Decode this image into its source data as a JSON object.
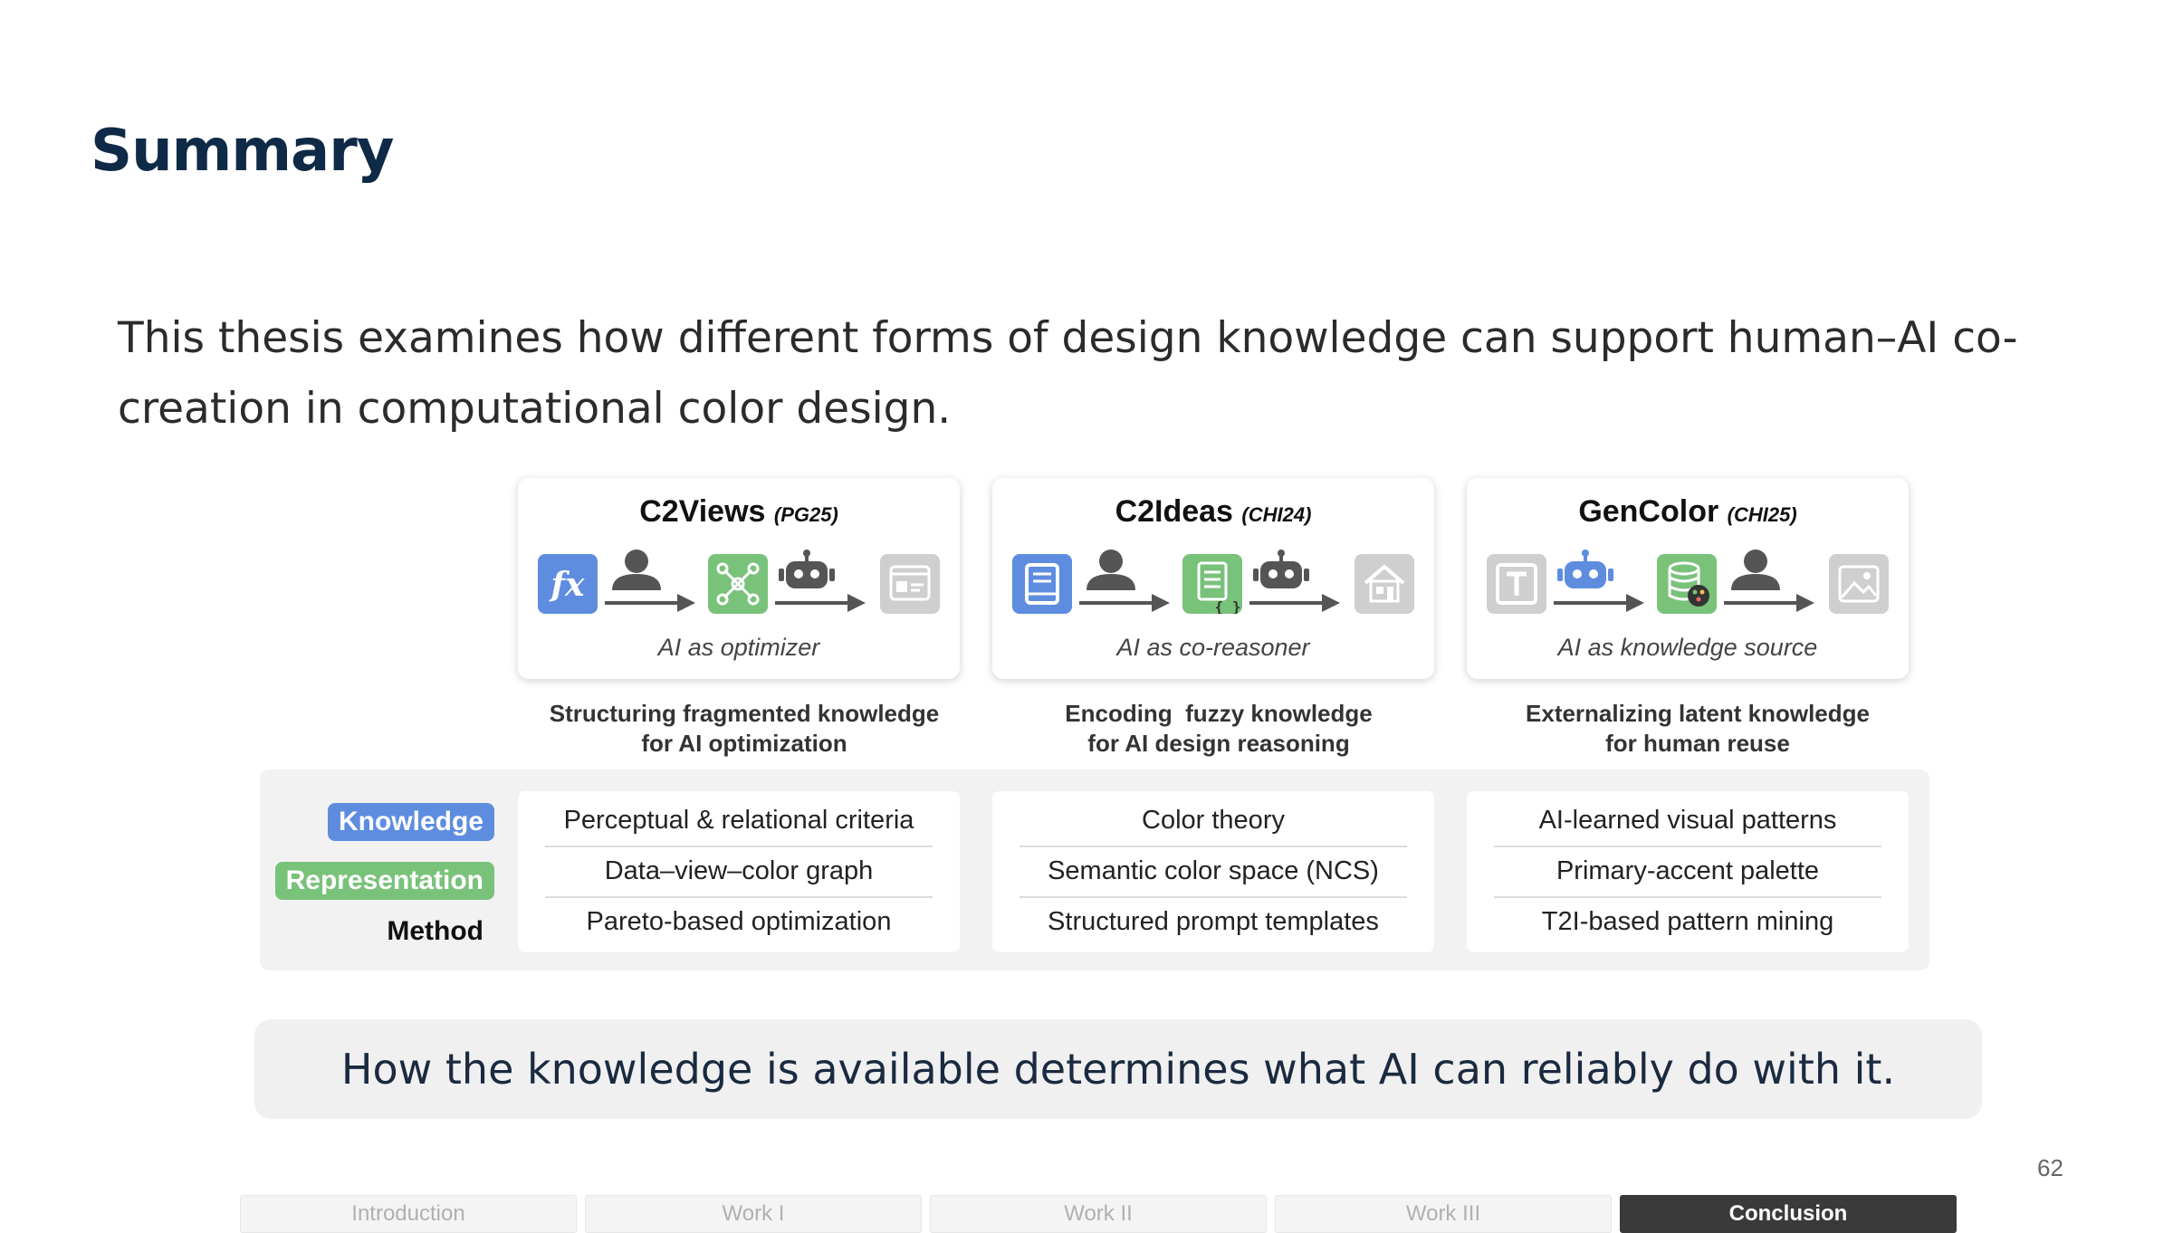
{
  "slide": {
    "title": "Summary",
    "intro": "This thesis examines how different forms of design knowledge can support human–AI co-creation in computational color design.",
    "page_number": "62"
  },
  "works": [
    {
      "name": "C2Views",
      "venue": "(PG25)",
      "caption": "AI as optimizer",
      "subtitle_line1": "Structuring fragmented knowledge",
      "subtitle_line2": "for AI optimization",
      "items": [
        "Perceptual & relational criteria",
        "Data–view–color graph",
        "Pareto-based optimization"
      ],
      "flow_icons": [
        "function-icon",
        "person-icon",
        "graph-icon",
        "robot-icon",
        "dashboard-icon"
      ]
    },
    {
      "name": "C2Ideas",
      "venue": "(CHI24)",
      "caption": "AI as co-reasoner",
      "subtitle_line1": "Encoding  fuzzy knowledge",
      "subtitle_line2": "for AI design reasoning",
      "items": [
        "Color theory",
        "Semantic color space (NCS)",
        "Structured prompt templates"
      ],
      "flow_icons": [
        "book-icon",
        "person-icon",
        "document-code-icon",
        "robot-icon",
        "house-icon"
      ]
    },
    {
      "name": "GenColor",
      "venue": "(CHI25)",
      "caption": "AI as knowledge source",
      "subtitle_line1": "Externalizing latent knowledge",
      "subtitle_line2": "for human reuse",
      "items": [
        "AI-learned visual patterns",
        "Primary-accent palette",
        "T2I-based pattern mining"
      ],
      "flow_icons": [
        "text-icon",
        "robot-icon",
        "database-palette-icon",
        "person-icon",
        "image-icon"
      ]
    }
  ],
  "legend": {
    "knowledge": "Knowledge",
    "representation": "Representation",
    "method": "Method",
    "knowledge_color": "#5e8de0",
    "representation_color": "#79c27a"
  },
  "conclusion": "How the knowledge is available determines what AI can reliably do with it.",
  "nav": {
    "tabs": [
      "Introduction",
      "Work I",
      "Work II",
      "Work III",
      "Conclusion"
    ],
    "active": "Conclusion"
  }
}
